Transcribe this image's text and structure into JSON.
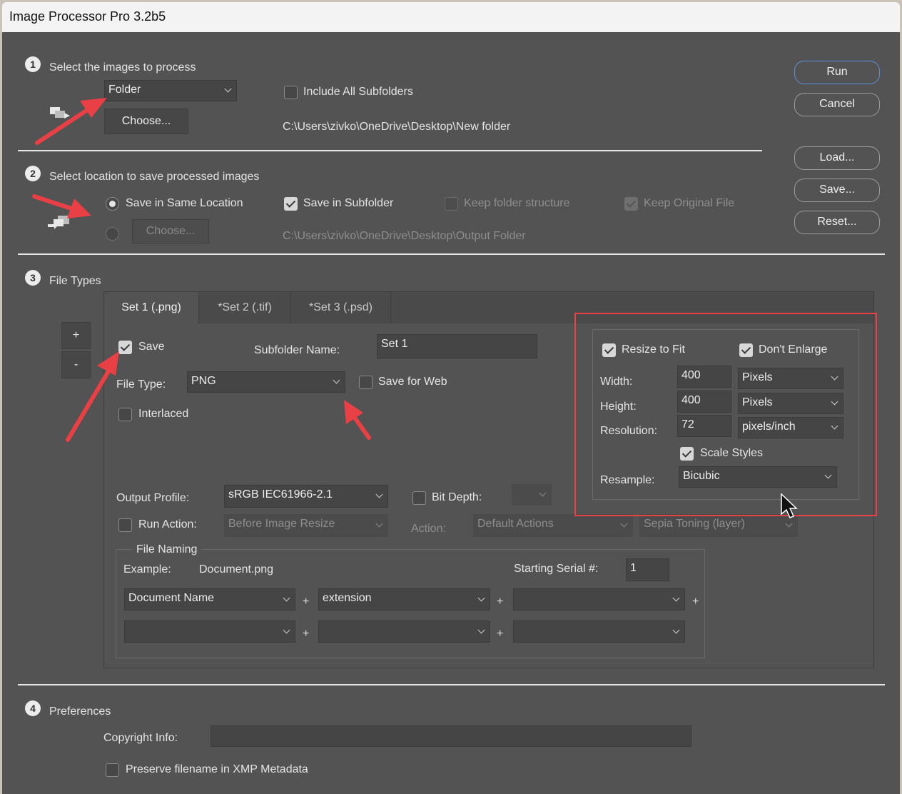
{
  "window": {
    "title": "Image Processor Pro 3.2b5"
  },
  "section1": {
    "number": "1",
    "heading": "Select the images to process",
    "source_select": "Folder",
    "choose_label": "Choose...",
    "include_subfolders_label": "Include All Subfolders",
    "include_subfolders_checked": false,
    "folder_path": "C:\\Users\\zivko\\OneDrive\\Desktop\\New folder"
  },
  "section2": {
    "number": "2",
    "heading": "Select location to save processed images",
    "same_location_label": "Save in Same Location",
    "same_location_selected": true,
    "choose_label": "Choose...",
    "save_subfolder_label": "Save in Subfolder",
    "save_subfolder_checked": true,
    "keep_structure_label": "Keep folder structure",
    "keep_original_label": "Keep Original File",
    "output_path": "C:\\Users\\zivko\\OneDrive\\Desktop\\Output Folder"
  },
  "section3": {
    "number": "3",
    "heading": "File Types",
    "add_label": "+",
    "remove_label": "-",
    "tabs": [
      {
        "label": "Set 1 (.png)",
        "active": true
      },
      {
        "label": "*Set 2 (.tif)",
        "active": false
      },
      {
        "label": "*Set 3 (.psd)",
        "active": false
      }
    ],
    "save_label": "Save",
    "save_checked": true,
    "subfolder_name_label": "Subfolder Name:",
    "subfolder_name_value": "Set 1",
    "file_type_label": "File Type:",
    "file_type_value": "PNG",
    "save_for_web_label": "Save for Web",
    "interlaced_label": "Interlaced",
    "resize": {
      "resize_to_fit_label": "Resize to Fit",
      "dont_enlarge_label": "Don't Enlarge",
      "width_label": "Width:",
      "width_value": "400",
      "width_unit": "Pixels",
      "height_label": "Height:",
      "height_value": "400",
      "height_unit": "Pixels",
      "resolution_label": "Resolution:",
      "resolution_value": "72",
      "resolution_unit": "pixels/inch",
      "scale_styles_label": "Scale Styles",
      "resample_label": "Resample:",
      "resample_value": "Bicubic"
    },
    "output_profile_label": "Output Profile:",
    "output_profile_value": "sRGB IEC61966-2.1",
    "bit_depth_label": "Bit Depth:",
    "run_action_label": "Run Action:",
    "run_action_when": "Before Image Resize",
    "action_label": "Action:",
    "action_set": "Default Actions",
    "action_name": "Sepia Toning (layer)",
    "file_naming": {
      "title": "File Naming",
      "example_label": "Example:",
      "example_value": "Document.png",
      "starting_serial_label": "Starting Serial #:",
      "starting_serial_value": "1",
      "row1": [
        "Document Name",
        "extension",
        ""
      ],
      "row2": [
        "",
        "",
        ""
      ],
      "plus": "+"
    }
  },
  "section4": {
    "number": "4",
    "heading": "Preferences",
    "copyright_label": "Copyright Info:",
    "copyright_value": "",
    "preserve_filename_label": "Preserve filename in XMP Metadata"
  },
  "buttons": {
    "run": "Run",
    "cancel": "Cancel",
    "load": "Load...",
    "save": "Save...",
    "reset": "Reset..."
  },
  "colors": {
    "dialog_bg": "#535353",
    "annotation_red": "#e94046",
    "primary_border": "#5d91d8"
  }
}
